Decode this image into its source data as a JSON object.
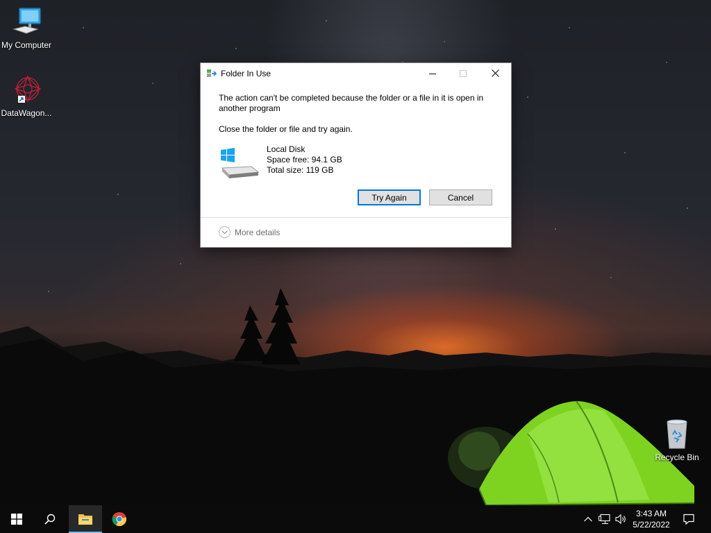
{
  "desktop": {
    "icons": [
      {
        "label": "My Computer",
        "icon": "computer-icon"
      },
      {
        "label": "DataWagon...",
        "icon": "datawagon-shortcut-icon"
      },
      {
        "label": "Recycle Bin",
        "icon": "recycle-bin-icon"
      }
    ]
  },
  "dialog": {
    "title": "Folder In Use",
    "message": "The action can't be completed because the folder or a file in it is open in another program",
    "instruction": "Close the folder or file and try again.",
    "drive": {
      "name": "Local Disk",
      "space_free": "Space free: 94.1 GB",
      "total_size": "Total size: 119 GB"
    },
    "buttons": {
      "try_again": "Try Again",
      "cancel": "Cancel"
    },
    "more_details": "More details",
    "controls": {
      "minimize": "minimize-icon",
      "maximize": "maximize-icon",
      "close": "close-icon"
    }
  },
  "taskbar": {
    "items": [
      "windows-start-icon",
      "search-icon",
      "file-explorer-icon",
      "chrome-icon"
    ],
    "tray": [
      "chevron-up-icon",
      "network-icon",
      "volume-icon",
      "notification-icon"
    ],
    "clock": {
      "time": "3:43 AM",
      "date": "5/22/2022"
    }
  },
  "colors": {
    "accent": "#0078d7",
    "taskbar": "#0c0c0c",
    "tent": "#7ed321"
  }
}
